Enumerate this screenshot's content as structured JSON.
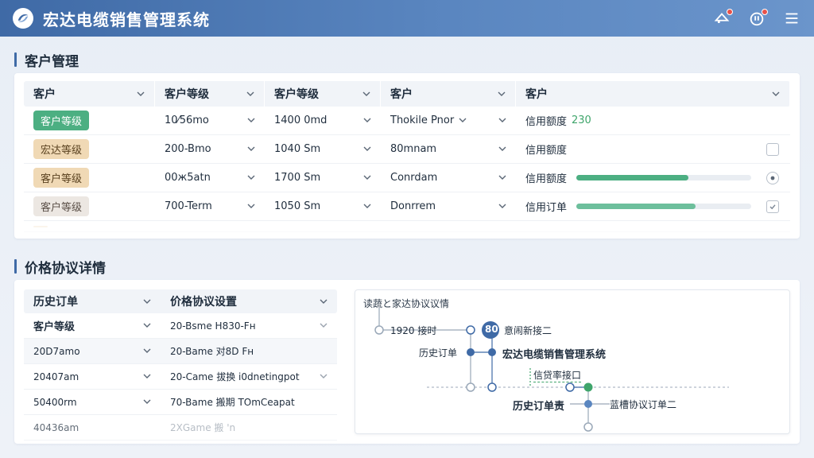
{
  "header": {
    "title": "宏达电缆销售管理系统",
    "icons": [
      "logo-icon",
      "message-icon",
      "power-icon",
      "menu-icon"
    ]
  },
  "customer_section": {
    "title": "客户管理",
    "columns": [
      "客户",
      "客户等级",
      "客户等级",
      "客户",
      "客户"
    ],
    "rows": [
      {
        "tag": "客户等级",
        "tag_style": "green",
        "c2": "10⁄56mo",
        "c3": "1400 0md",
        "c4": "Thokile Pnor",
        "credit": "信用额度",
        "credit_value": "230",
        "bar": null,
        "ctrl": "none"
      },
      {
        "tag": "宏达等级",
        "tag_style": "tan",
        "c2": "200-Bmo",
        "c3": "1040 Sm",
        "c4": "80mnam",
        "credit": "信用额度",
        "credit_value": "",
        "bar": null,
        "ctrl": "checkbox"
      },
      {
        "tag": "客户等级",
        "tag_style": "tan",
        "c2": "00ж5atn",
        "c3": "1700 Sm",
        "c4": "Conrdam",
        "credit": "信用额度",
        "credit_value": "",
        "bar": 0.64,
        "ctrl": "radio"
      },
      {
        "tag": "客户等级",
        "tag_style": "grey",
        "c2": "700-Term",
        "c3": "1050 Sm",
        "c4": "Donrrem",
        "credit": "信用订单",
        "credit_value": "",
        "bar": 0.68,
        "ctrl": "checkbox-checked"
      }
    ],
    "colors": {
      "accent": "#3f6aa6",
      "green_tag": "#4caf82",
      "bar_green": "#4caf82",
      "bar_teal": "#6dbf9c"
    }
  },
  "price_section": {
    "title": "价格协议详情",
    "columns": [
      "历史订单",
      "价格协议设置"
    ],
    "rows": [
      {
        "c1": "客户等级",
        "c2": "20-Bsme H830-Fн"
      },
      {
        "c1": "20D7amo",
        "c2": "20-Bame 对8D Fн"
      },
      {
        "c1": "20407am",
        "c2": "20-Came 拔换 i0dnetingpot"
      },
      {
        "c1": "50400rm",
        "c2": "70-Bame 搬期 TOmCeapat"
      },
      {
        "c1": "40436am",
        "c2": "2XGame 搬 'n"
      }
    ]
  },
  "flow": {
    "title": "读蔬と家达协议议情",
    "labels": {
      "start_text": "1920 接时",
      "badge": "80",
      "new_node": "意闹新接二",
      "history": "历史订单",
      "system": "宏达电缆销售管理系统",
      "credit_port": "信贷率接口",
      "history_order": "历史订单责",
      "approve": "蓝槽协议订单二"
    }
  }
}
